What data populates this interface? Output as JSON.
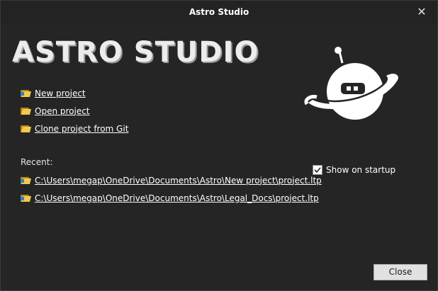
{
  "window": {
    "title": "Astro Studio",
    "close_glyph": "✕"
  },
  "logo": {
    "text": "ASTRO STUDIO",
    "mascot_icon": "astronaut-planet-logo"
  },
  "actions": [
    {
      "label": "New project",
      "icon": "folder-new-icon"
    },
    {
      "label": "Open project",
      "icon": "folder-open-icon"
    },
    {
      "label": "Clone project from Git",
      "icon": "folder-git-icon"
    }
  ],
  "recent": {
    "label": "Recent:",
    "items": [
      {
        "path": "C:\\Users\\megap\\OneDrive\\Documents\\Astro\\New project\\project.ltp",
        "icon": "project-file-icon"
      },
      {
        "path": "C:\\Users\\megap\\OneDrive\\Documents\\Astro\\Legal_Docs\\project.ltp",
        "icon": "project-file-icon"
      }
    ]
  },
  "startup": {
    "label": "Show on startup",
    "checked": true
  },
  "footer": {
    "close_label": "Close"
  },
  "colors": {
    "background": "#252525",
    "text": "#ffffff",
    "folder": "#f4c94a",
    "button": "#e1e1e1"
  }
}
